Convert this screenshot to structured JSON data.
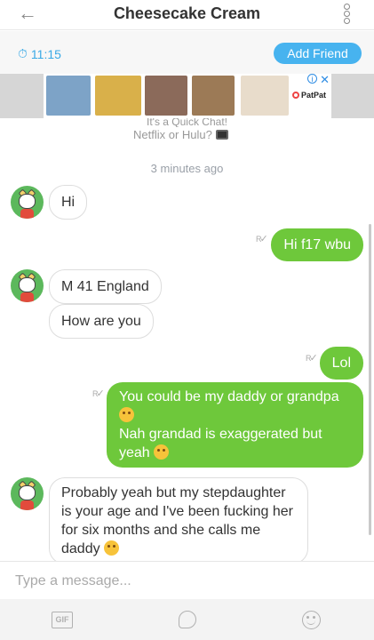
{
  "header": {
    "title": "Cheesecake Cream",
    "back_icon": "arrow-left-icon",
    "menu_icon": "vertical-more-icon"
  },
  "status": {
    "timer": "11:15",
    "add_friend_label": "Add Friend"
  },
  "ad": {
    "brand": "PatPat",
    "info_icon": "info-icon",
    "close_icon": "close-icon"
  },
  "intro": {
    "line1": "It's a Quick Chat!",
    "line2": "Netflix or Hulu?"
  },
  "timestamp": "3 minutes ago",
  "messages": [
    {
      "side": "in",
      "text": "Hi"
    },
    {
      "side": "out",
      "text": "Hi f17 wbu"
    },
    {
      "side": "in",
      "text": "M 41 England"
    },
    {
      "side": "in",
      "text": "How are you"
    },
    {
      "side": "out",
      "text": "Lol"
    },
    {
      "side": "out",
      "line1": "You could be my daddy or grandpa",
      "line2": "Nah grandad is exaggerated but yeah"
    },
    {
      "side": "in",
      "text": "Probably yeah but my stepdaughter is your age and I've been fucking her for six months and she calls me daddy"
    }
  ],
  "composer": {
    "placeholder": "Type a message..."
  },
  "toolbar": {
    "gif_label": "GIF",
    "sticker_icon": "sticker-icon",
    "emoji_icon": "emoji-icon"
  },
  "colors": {
    "accent_blue": "#47b3ef",
    "outgoing_green": "#6ec83b",
    "avatar_green": "#5cb85c"
  }
}
